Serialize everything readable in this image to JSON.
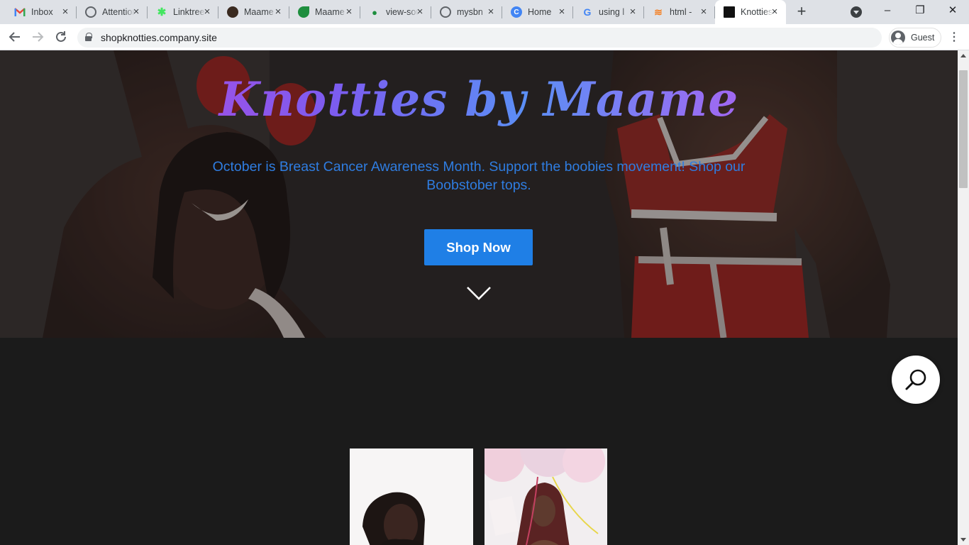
{
  "browser": {
    "tabs": [
      {
        "title": "Inbox",
        "icon": "gmail-icon",
        "color": "#ea4335"
      },
      {
        "title": "Attention",
        "icon": "globe-icon",
        "color": "#5f6368"
      },
      {
        "title": "Linktree",
        "icon": "linktree-icon",
        "color": "#43e660"
      },
      {
        "title": "Maame",
        "icon": "avatar-icon",
        "color": "#3a2a20"
      },
      {
        "title": "Maame",
        "icon": "leaf-icon",
        "color": "#1e8e3e"
      },
      {
        "title": "view-source",
        "icon": "person-icon",
        "color": "#1e8e3e"
      },
      {
        "title": "mysbn",
        "icon": "globe-icon",
        "color": "#5f6368"
      },
      {
        "title": "Home",
        "icon": "c-logo-icon",
        "color": "#4285f4"
      },
      {
        "title": "using l",
        "icon": "google-icon",
        "color": "#4285f4"
      },
      {
        "title": "html -",
        "icon": "stackoverflow-icon",
        "color": "#f48024"
      },
      {
        "title": "Knotties",
        "icon": "site-icon",
        "color": "#111111"
      }
    ],
    "url": "shopknotties.company.site",
    "profile_name": "Guest"
  },
  "hero": {
    "brand_title": "Knotties by Maame",
    "tagline": "October is Breast Cancer Awareness Month. Support the boobies movement! Shop our Boobstober tops.",
    "cta_label": "Shop Now"
  },
  "colors": {
    "tagline": "#2f7de1",
    "cta_bg": "#1f7fe6",
    "page_bg": "#1b1b1b"
  }
}
